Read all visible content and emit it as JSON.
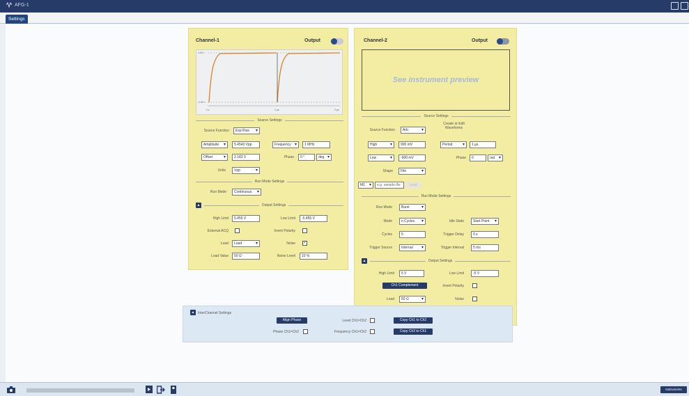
{
  "window": {
    "title": "AFG-1"
  },
  "tabs": [
    {
      "label": "Settings"
    }
  ],
  "ch1": {
    "title": "Channel-1",
    "output_label": "Output",
    "plot": {
      "y_top": "4.00 v",
      "y_bottom": "-2.00 v",
      "x_start": "0 s",
      "x_mid": "1 µs",
      "x_end": "2 µs"
    },
    "source_title": "Source Settings",
    "source_function_label": "Source Function",
    "source_function": "Exp Rise",
    "amplitude_sel": "Amplitude",
    "amplitude": "5.4543 Vpp",
    "frequency_sel": "Frequency",
    "frequency": "1 MHz",
    "offset_sel": "Offset",
    "offset": "2.183 V",
    "phase_label": "Phase",
    "phase": "0 °",
    "phase_unit": "deg",
    "units_label": "Units",
    "units": "Vpp",
    "runmode_title": "Run Mode Settings",
    "run_mode_label": "Run Mode",
    "run_mode": "Continuous",
    "output_title": "Output Settings",
    "high_limit_label": "High Limit",
    "high_limit": "5.455 V",
    "low_limit_label": "Low Limit",
    "low_limit": "-5.455 V",
    "external_acq_label": "External ACQ",
    "invert_polarity_label": "Invert Polarity",
    "load_label": "Load",
    "load": "Load",
    "noise_label": "Noise",
    "load_value_label": "Load Value",
    "load_value": "50 Ω",
    "noise_level_label": "Noise Level",
    "noise_level": "10 %"
  },
  "ch2": {
    "title": "Channel-2",
    "output_label": "Output",
    "preview_text": "See instrument preview",
    "source_title": "Source Settings",
    "source_function_label": "Source Function",
    "source_function": "Arb",
    "create_edit_label": "Create or Edit Waveforms",
    "high_sel": "High",
    "high": "900 mV",
    "period_sel": "Period",
    "period": "1 µs",
    "low_sel": "Low",
    "low": "-900 mV",
    "phase_label": "Phase",
    "phase": "0",
    "phase_unit": "rad",
    "shape_label": "Shape",
    "shape": "File",
    "file_sel": "M1",
    "file_placeholder": "e.g. sample.tfw",
    "load_btn": "Load",
    "runmode_title": "Run Mode Settings",
    "run_mode_label": "Run Mode",
    "run_mode": "Burst",
    "mode_label": "Mode",
    "mode": "n Cycles",
    "idle_state_label": "Idle State",
    "idle_state": "Start Point",
    "cycles_label": "Cycles",
    "cycles": "5",
    "trigger_delay_label": "Trigger Delay",
    "trigger_delay": "0 s",
    "trigger_source_label": "Trigger Source",
    "trigger_source": "Internal",
    "trigger_interval_label": "Trigger Interval",
    "trigger_interval": "5 ms",
    "output_title": "Output Settings",
    "high_limit_label": "High Limit",
    "high_limit": "5 V",
    "low_limit_label": "Low Limit",
    "low_limit": "-5 V",
    "ch1_complement_btn": "Ch1 Complement",
    "invert_polarity_label": "Invert Polarity",
    "load_label": "Load",
    "load": "50 Ω",
    "noise_label": "Noise"
  },
  "inter": {
    "title": "InterChannel Settings",
    "align_phase_btn": "Align Phase",
    "phase_label": "Phase Ch1=Ch2",
    "level_label": "Level Ch1=Ch2",
    "frequency_label": "Frequency Ch1=Ch2",
    "copy12_btn": "Copy Ch1 to Ch2",
    "copy21_btn": "Copy Ch2 to Ch1"
  },
  "bottom": {
    "instruments_btn": "Instruments"
  },
  "colors": {
    "panel": "#f2eda2",
    "accent": "#263b68",
    "curve": "#d98220"
  }
}
